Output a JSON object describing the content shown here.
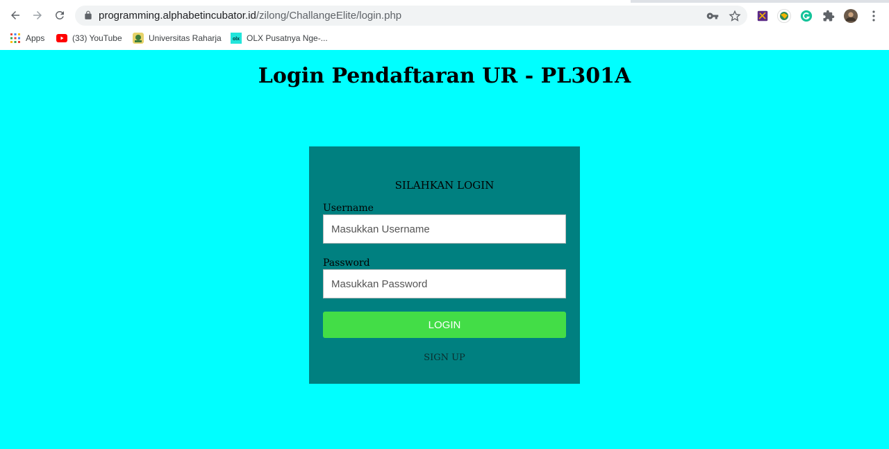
{
  "browser": {
    "url_host": "programming.alphabetincubator.id",
    "url_path": "/zilong/ChallangeElite/login.php",
    "bookmarks": [
      {
        "label": "Apps",
        "icon": "apps-grid-icon"
      },
      {
        "label": "(33) YouTube",
        "icon": "youtube-icon"
      },
      {
        "label": "Universitas Raharja",
        "icon": "raharja-icon"
      },
      {
        "label": "OLX Pusatnya Nge-...",
        "icon": "olx-icon"
      }
    ],
    "extensions": [
      "mail-extension-icon",
      "globe-extension-icon",
      "grammarly-icon",
      "puzzle-icon",
      "profile-avatar"
    ],
    "colors": {
      "youtube": "#ff0000",
      "grammarly": "#15c39a"
    }
  },
  "page": {
    "title": "Login Pendaftaran UR - PL301A",
    "background": "#00ffff"
  },
  "login_panel": {
    "heading": "SILAHKAN LOGIN",
    "username_label": "Username",
    "username_placeholder": "Masukkan Username",
    "password_label": "Password",
    "password_placeholder": "Masukkan Password",
    "login_button": "LOGIN",
    "signup_link": "SIGN UP",
    "colors": {
      "panel": "#008080",
      "button": "#43dd47"
    }
  }
}
